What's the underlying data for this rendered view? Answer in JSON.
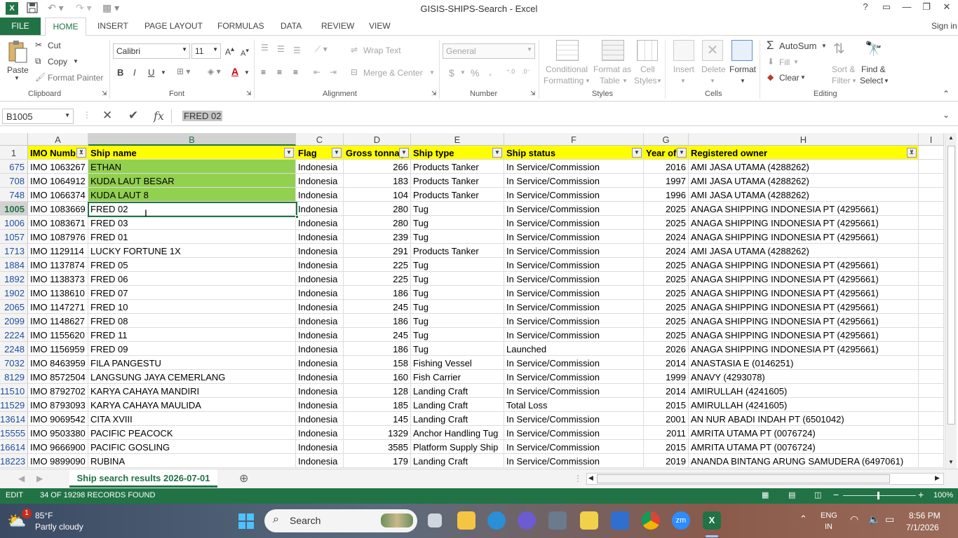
{
  "window": {
    "title": "GISIS-SHIPS-Search - Excel",
    "help": "?",
    "sign_in": "Sign in"
  },
  "ribbon_tabs": [
    "FILE",
    "HOME",
    "INSERT",
    "PAGE LAYOUT",
    "FORMULAS",
    "DATA",
    "REVIEW",
    "VIEW"
  ],
  "ribbon": {
    "clipboard": {
      "paste": "Paste",
      "cut": "Cut",
      "copy": "Copy",
      "format_painter": "Format Painter",
      "label": "Clipboard"
    },
    "font": {
      "font_name": "Calibri",
      "font_size": "11",
      "bold": "B",
      "italic": "I",
      "underline": "U",
      "label": "Font"
    },
    "alignment": {
      "wrap_text": "Wrap Text",
      "merge_center": "Merge & Center",
      "label": "Alignment"
    },
    "number": {
      "format": "General",
      "currency": "$",
      "percent": "%",
      "comma": ",",
      "label": "Number"
    },
    "styles": {
      "conditional_1": "Conditional",
      "conditional_2": "Formatting",
      "format_table_1": "Format as",
      "format_table_2": "Table",
      "cell_styles_1": "Cell",
      "cell_styles_2": "Styles",
      "label": "Styles"
    },
    "cells": {
      "insert": "Insert",
      "delete": "Delete",
      "format": "Format",
      "label": "Cells"
    },
    "editing": {
      "autosum": "AutoSum",
      "fill": "Fill",
      "clear": "Clear",
      "sort_1": "Sort &",
      "sort_2": "Filter",
      "find_1": "Find &",
      "find_2": "Select",
      "label": "Editing"
    }
  },
  "formula_bar": {
    "name_box": "B1005",
    "content": "FRED 02",
    "cancel": "✕",
    "enter": "✔",
    "fx": "fx"
  },
  "columns": [
    "A",
    "B",
    "C",
    "D",
    "E",
    "F",
    "G",
    "H",
    "I"
  ],
  "header_row": {
    "row_number": "1",
    "cells": [
      "IMO Numb",
      "Ship name",
      "Flag",
      "Gross tonnag",
      "Ship type",
      "Ship status",
      "Year of",
      "Registered owner"
    ]
  },
  "rows": [
    {
      "row": "675",
      "imo": "IMO 1063267",
      "name": "ETHAN",
      "flag": "Indonesia",
      "gt": "266",
      "type": "Products Tanker",
      "status": "In Service/Commission",
      "year": "2016",
      "owner": "AMI JASA UTAMA (4288262)",
      "highlight": true
    },
    {
      "row": "708",
      "imo": "IMO 1064912",
      "name": "KUDA LAUT BESAR",
      "flag": "Indonesia",
      "gt": "183",
      "type": "Products Tanker",
      "status": "In Service/Commission",
      "year": "1997",
      "owner": "AMI JASA UTAMA (4288262)",
      "highlight": true
    },
    {
      "row": "748",
      "imo": "IMO 1066374",
      "name": "KUDA LAUT 8",
      "flag": "Indonesia",
      "gt": "104",
      "type": "Products Tanker",
      "status": "In Service/Commission",
      "year": "1996",
      "owner": "AMI JASA UTAMA (4288262)",
      "highlight": true
    },
    {
      "row": "1005",
      "imo": "IMO 1083669",
      "name": "FRED 02",
      "flag": "Indonesia",
      "gt": "280",
      "type": "Tug",
      "status": "In Service/Commission",
      "year": "2025",
      "owner": "ANAGA SHIPPING INDONESIA PT (4295661)",
      "highlight": false
    },
    {
      "row": "1006",
      "imo": "IMO 1083671",
      "name": "FRED 03",
      "flag": "Indonesia",
      "gt": "280",
      "type": "Tug",
      "status": "In Service/Commission",
      "year": "2025",
      "owner": "ANAGA SHIPPING INDONESIA PT (4295661)",
      "highlight": false
    },
    {
      "row": "1057",
      "imo": "IMO 1087976",
      "name": "FRED 01",
      "flag": "Indonesia",
      "gt": "239",
      "type": "Tug",
      "status": "In Service/Commission",
      "year": "2024",
      "owner": "ANAGA SHIPPING INDONESIA PT (4295661)",
      "highlight": false
    },
    {
      "row": "1713",
      "imo": "IMO 1129114",
      "name": "LUCKY FORTUNE 1X",
      "flag": "Indonesia",
      "gt": "291",
      "type": "Products Tanker",
      "status": "In Service/Commission",
      "year": "2024",
      "owner": "AMI JASA UTAMA (4288262)",
      "highlight": false
    },
    {
      "row": "1884",
      "imo": "IMO 1137874",
      "name": "FRED 05",
      "flag": "Indonesia",
      "gt": "225",
      "type": "Tug",
      "status": "In Service/Commission",
      "year": "2025",
      "owner": "ANAGA SHIPPING INDONESIA PT (4295661)",
      "highlight": false
    },
    {
      "row": "1892",
      "imo": "IMO 1138373",
      "name": "FRED 06",
      "flag": "Indonesia",
      "gt": "225",
      "type": "Tug",
      "status": "In Service/Commission",
      "year": "2025",
      "owner": "ANAGA SHIPPING INDONESIA PT (4295661)",
      "highlight": false
    },
    {
      "row": "1902",
      "imo": "IMO 1138610",
      "name": "FRED 07",
      "flag": "Indonesia",
      "gt": "186",
      "type": "Tug",
      "status": "In Service/Commission",
      "year": "2025",
      "owner": "ANAGA SHIPPING INDONESIA PT (4295661)",
      "highlight": false
    },
    {
      "row": "2065",
      "imo": "IMO 1147271",
      "name": "FRED 10",
      "flag": "Indonesia",
      "gt": "245",
      "type": "Tug",
      "status": "In Service/Commission",
      "year": "2025",
      "owner": "ANAGA SHIPPING INDONESIA PT (4295661)",
      "highlight": false
    },
    {
      "row": "2099",
      "imo": "IMO 1148627",
      "name": "FRED 08",
      "flag": "Indonesia",
      "gt": "186",
      "type": "Tug",
      "status": "In Service/Commission",
      "year": "2025",
      "owner": "ANAGA SHIPPING INDONESIA PT (4295661)",
      "highlight": false
    },
    {
      "row": "2224",
      "imo": "IMO 1155620",
      "name": "FRED 11",
      "flag": "Indonesia",
      "gt": "245",
      "type": "Tug",
      "status": "In Service/Commission",
      "year": "2025",
      "owner": "ANAGA SHIPPING INDONESIA PT (4295661)",
      "highlight": false
    },
    {
      "row": "2248",
      "imo": "IMO 1156959",
      "name": "FRED 09",
      "flag": "Indonesia",
      "gt": "186",
      "type": "Tug",
      "status": "Launched",
      "year": "2026",
      "owner": "ANAGA SHIPPING INDONESIA PT (4295661)",
      "highlight": false
    },
    {
      "row": "7032",
      "imo": "IMO 8463959",
      "name": "FILA PANGESTU",
      "flag": "Indonesia",
      "gt": "158",
      "type": "Fishing Vessel",
      "status": "In Service/Commission",
      "year": "2014",
      "owner": "ANASTASIA E (0146251)",
      "highlight": false
    },
    {
      "row": "8129",
      "imo": "IMO 8572504",
      "name": "LANGSUNG JAYA CEMERLANG",
      "flag": "Indonesia",
      "gt": "160",
      "type": "Fish Carrier",
      "status": "In Service/Commission",
      "year": "1999",
      "owner": "ANAVY (4293078)",
      "highlight": false
    },
    {
      "row": "11510",
      "imo": "IMO 8792702",
      "name": "KARYA CAHAYA MANDIRI",
      "flag": "Indonesia",
      "gt": "128",
      "type": "Landing Craft",
      "status": "In Service/Commission",
      "year": "2014",
      "owner": "AMIRULLAH (4241605)",
      "highlight": false
    },
    {
      "row": "11529",
      "imo": "IMO 8793093",
      "name": "KARYA CAHAYA MAULIDA",
      "flag": "Indonesia",
      "gt": "185",
      "type": "Landing Craft",
      "status": "Total Loss",
      "year": "2015",
      "owner": "AMIRULLAH (4241605)",
      "highlight": false
    },
    {
      "row": "13614",
      "imo": "IMO 9069542",
      "name": "CITA XVIII",
      "flag": "Indonesia",
      "gt": "145",
      "type": "Landing Craft",
      "status": "In Service/Commission",
      "year": "2001",
      "owner": "AN NUR ABADI INDAH PT (6501042)",
      "highlight": false
    },
    {
      "row": "15555",
      "imo": "IMO 9503380",
      "name": "PACIFIC PEACOCK",
      "flag": "Indonesia",
      "gt": "1329",
      "type": "Anchor Handling Tug",
      "status": "In Service/Commission",
      "year": "2011",
      "owner": "AMRITA UTAMA PT (0076724)",
      "highlight": false
    },
    {
      "row": "16614",
      "imo": "IMO 9666900",
      "name": "PACIFIC GOSLING",
      "flag": "Indonesia",
      "gt": "3585",
      "type": "Platform Supply Ship",
      "status": "In Service/Commission",
      "year": "2015",
      "owner": "AMRITA UTAMA PT (0076724)",
      "highlight": false
    },
    {
      "row": "18223",
      "imo": "IMO 9899090",
      "name": "RUBINA",
      "flag": "Indonesia",
      "gt": "179",
      "type": "Landing Craft",
      "status": "In Service/Commission",
      "year": "2019",
      "owner": "ANANDA BINTANG ARUNG SAMUDERA (6497061)",
      "highlight": false
    }
  ],
  "sheet_tab": "Ship search results 2026-07-01",
  "status_bar": {
    "mode": "EDIT",
    "records": "34 OF 19298 RECORDS FOUND",
    "zoom": "100%"
  },
  "taskbar": {
    "weather_temp": "85°F",
    "weather_desc": "Partly cloudy",
    "weather_badge": "1",
    "search": "Search",
    "lang": "ENG",
    "region": "IN",
    "time": "8:56 PM",
    "date": "7/1/2026"
  },
  "colors": {
    "excel_green": "#217346",
    "header_yellow": "#ffff00",
    "highlight_green": "#92d050"
  }
}
